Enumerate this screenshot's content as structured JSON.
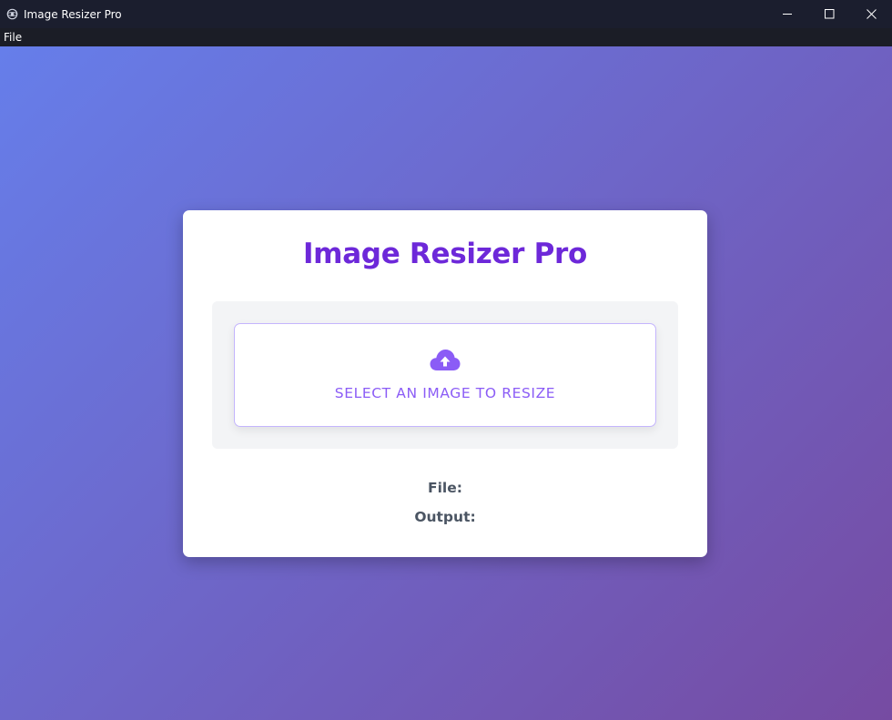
{
  "window": {
    "title": "Image Resizer Pro"
  },
  "menu": {
    "items": [
      "File"
    ]
  },
  "card": {
    "title": "Image Resizer Pro",
    "upload_label": "SELECT AN IMAGE TO RESIZE",
    "file_label": "File:",
    "output_label": "Output:"
  },
  "colors": {
    "accent": "#6d28d9",
    "upload_text": "#8b5cf6",
    "gradient_start": "#667eea",
    "gradient_end": "#764ba2"
  },
  "icons": {
    "upload": "cloud-upload-icon"
  }
}
